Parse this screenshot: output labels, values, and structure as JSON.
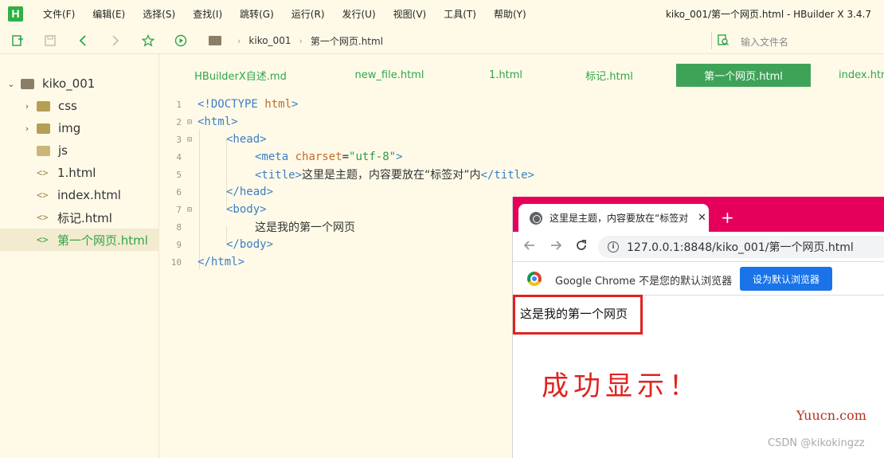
{
  "app": {
    "logo_letter": "H",
    "window_title": "kiko_001/第一个网页.html - HBuilder X 3.4.7",
    "accent_color": "#2fa54a"
  },
  "menubar": {
    "items": [
      "文件(F)",
      "编辑(E)",
      "选择(S)",
      "查找(I)",
      "跳转(G)",
      "运行(R)",
      "发行(U)",
      "视图(V)",
      "工具(T)",
      "帮助(Y)"
    ]
  },
  "toolbar": {
    "breadcrumb": [
      "kiko_001",
      "第一个网页.html"
    ],
    "file_search_placeholder": "输入文件名",
    "icons": [
      "new-file-icon",
      "save-icon",
      "back-icon",
      "forward-icon",
      "star-icon",
      "run-icon",
      "folder-icon",
      "search-file-icon"
    ]
  },
  "sidebar": {
    "root": "kiko_001",
    "items": [
      {
        "label": "css",
        "kind": "folder"
      },
      {
        "label": "img",
        "kind": "folder"
      },
      {
        "label": "js",
        "kind": "folder-open"
      },
      {
        "label": "1.html",
        "kind": "file"
      },
      {
        "label": "index.html",
        "kind": "file"
      },
      {
        "label": "标记.html",
        "kind": "file"
      },
      {
        "label": "第一个网页.html",
        "kind": "file",
        "active": true
      }
    ]
  },
  "tabs": [
    {
      "label": "HBuilderX自述.md"
    },
    {
      "label": "new_file.html"
    },
    {
      "label": "1.html"
    },
    {
      "label": "标记.html"
    },
    {
      "label": "第一个网页.html",
      "active": true
    },
    {
      "label": "index.htm"
    }
  ],
  "editor": {
    "line_numbers": [
      "1",
      "2",
      "3",
      "4",
      "5",
      "6",
      "7",
      "8",
      "9",
      "10"
    ],
    "lines": {
      "l1_tag": "<!DOCTYPE",
      "l1_attr": "html",
      "l1_close": ">",
      "l2": "<html>",
      "l3": "<head>",
      "l4_tag": "<meta",
      "l4_attr": "charset",
      "l4_eq": "=",
      "l4_val": "\"utf-8\"",
      "l4_close": ">",
      "l5_open": "<title>",
      "l5_text": "这里是主题，内容要放在“标签对”内",
      "l5_close": "</title>",
      "l6": "</head>",
      "l7": "<body>",
      "l8_text": "这是我的第一个网页",
      "l9": "</body>",
      "l10": "</html>"
    }
  },
  "browser": {
    "tab_title": "这里是主题，内容要放在“标签对",
    "tab_close": "✕",
    "new_tab": "+",
    "url": "127.0.0.1:8848/kiko_001/第一个网页.html",
    "infobar_text": "Google Chrome 不是您的默认浏览器",
    "default_button": "设为默认浏览器",
    "page_text": "这是我的第一个网页",
    "tab_color": "#e6005b"
  },
  "annotations": {
    "success_text": "成功显示！",
    "watermark_yuucn": "Yuucn.com",
    "watermark_csdn": "CSDN @kikokingzz",
    "highlight_color": "#e0221f"
  }
}
